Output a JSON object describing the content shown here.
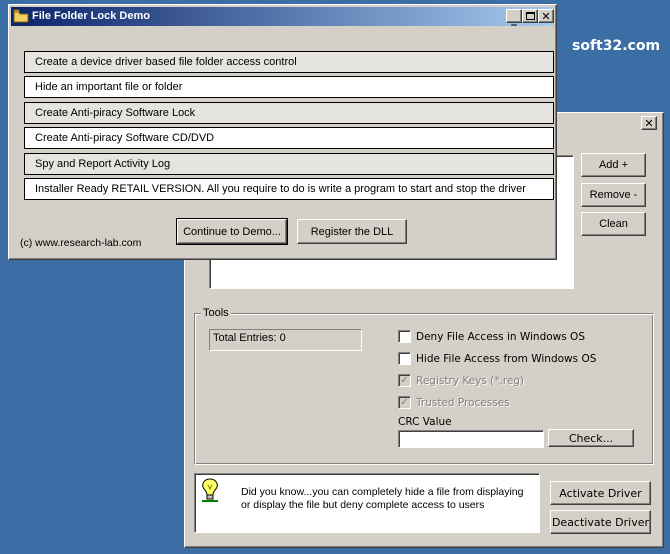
{
  "watermark": "soft32.com",
  "demo_window": {
    "title": "File Folder Lock Demo",
    "features": [
      "Create a device driver based file folder access control",
      "Hide an important file or folder",
      "Create Anti-piracy Software Lock",
      "Create Anti-piracy Software CD/DVD",
      "Spy and Report Activity Log",
      "Installer Ready RETAIL VERSION. All you require to do is write a program to start and stop the driver"
    ],
    "copyright": "(c) www.research-lab.com",
    "continue_label": "Continue to Demo...",
    "register_label": "Register the DLL"
  },
  "main_window": {
    "add_label": "Add +",
    "remove_label": "Remove -",
    "clean_label": "Clean",
    "tools": {
      "label": "Tools",
      "total_entries": "Total Entries: 0",
      "deny_access_label": "Deny File Access in Windows OS",
      "deny_access_checked": false,
      "hide_access_label": "Hide File Access from Windows  OS",
      "hide_access_checked": false,
      "registry_keys_label": "Registry Keys (*.reg)",
      "registry_keys_checked": true,
      "trusted_processes_label": "Trusted Processes",
      "trusted_processes_checked": true,
      "crc_label": "CRC Value",
      "crc_value": "",
      "check_label": "Check..."
    },
    "tip_text": "Did you know...you can completely hide a file from displaying or display the file but deny complete access to users",
    "activate_label": "Activate Driver",
    "deactivate_label": "Deactivate Driver"
  },
  "colors": {
    "desktop": "#3a6ea5",
    "title_bar_start": "#0a246a",
    "title_bar_end": "#a6caf0",
    "face": "#d4d0c8"
  },
  "icons": {
    "demo_app": "folder-lock-icon",
    "tip": "lightbulb-icon"
  }
}
